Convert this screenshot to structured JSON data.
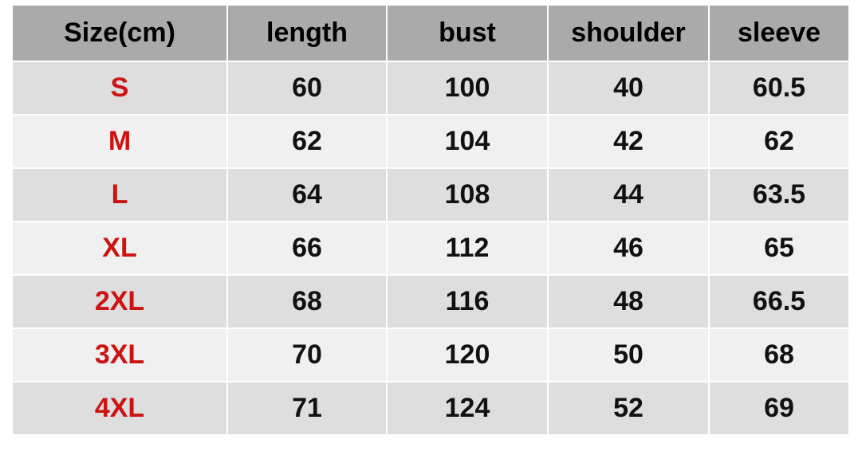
{
  "table": {
    "headers": [
      "Size(cm)",
      "length",
      "bust",
      "shoulder",
      "sleeve"
    ],
    "rows": [
      {
        "size": "S",
        "length": "60",
        "bust": "100",
        "shoulder": "40",
        "sleeve": "60.5"
      },
      {
        "size": "M",
        "length": "62",
        "bust": "104",
        "shoulder": "42",
        "sleeve": "62"
      },
      {
        "size": "L",
        "length": "64",
        "bust": "108",
        "shoulder": "44",
        "sleeve": "63.5"
      },
      {
        "size": "XL",
        "length": "66",
        "bust": "112",
        "shoulder": "46",
        "sleeve": "65"
      },
      {
        "size": "2XL",
        "length": "68",
        "bust": "116",
        "shoulder": "48",
        "sleeve": "66.5"
      },
      {
        "size": "3XL",
        "length": "70",
        "bust": "120",
        "shoulder": "50",
        "sleeve": "68"
      },
      {
        "size": "4XL",
        "length": "71",
        "bust": "124",
        "shoulder": "52",
        "sleeve": "69"
      }
    ]
  },
  "colors": {
    "header_bg": "#aaaaaa",
    "row_dark": "#dedede",
    "row_light": "#f0f0f0",
    "size_label": "#cc1212",
    "value_text": "#111111",
    "page_bg": "#ffffff"
  }
}
